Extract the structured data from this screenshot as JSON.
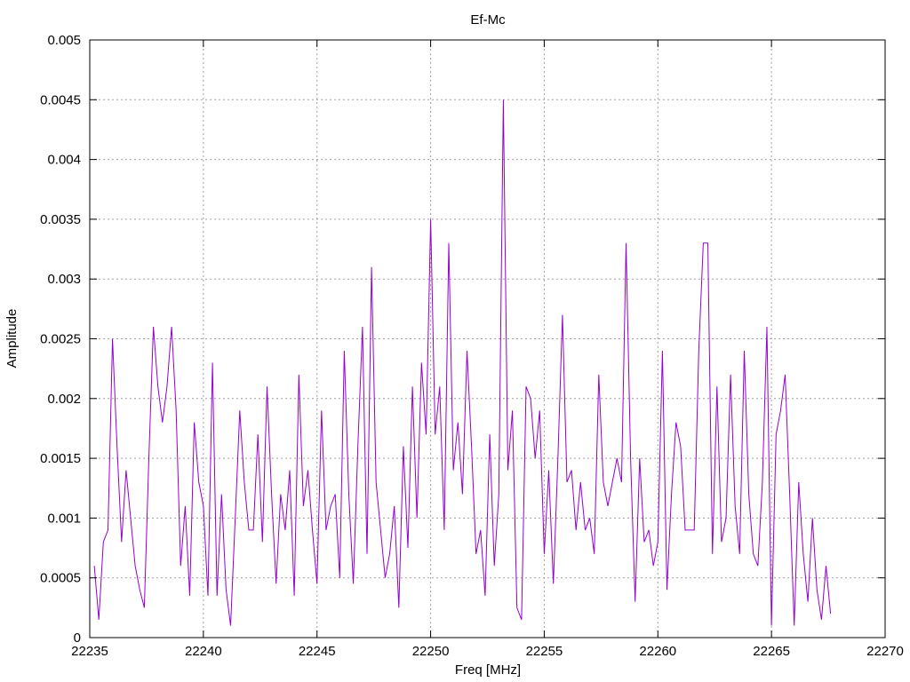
{
  "chart_data": {
    "type": "line",
    "title": "Ef-Mc",
    "xlabel": "Freq [MHz]",
    "ylabel": "Amplitude",
    "xlim": [
      22235,
      22270
    ],
    "ylim": [
      0,
      0.005
    ],
    "xticks": [
      22235,
      22240,
      22245,
      22250,
      22255,
      22260,
      22265,
      22270
    ],
    "xtick_labels": [
      "22235",
      "22240",
      "22245",
      "22250",
      "22255",
      "22260",
      "22265",
      "22270"
    ],
    "yticks": [
      0,
      0.0005,
      0.001,
      0.0015,
      0.002,
      0.0025,
      0.003,
      0.0035,
      0.004,
      0.0045,
      0.005
    ],
    "ytick_labels": [
      "0",
      "0.0005",
      "0.001",
      "0.0015",
      "0.002",
      "0.0025",
      "0.003",
      "0.0035",
      "0.004",
      "0.0045",
      "0.005"
    ],
    "grid": true,
    "series": [
      {
        "color": "#9400d3",
        "x": [
          22235.2,
          22235.4,
          22235.6,
          22235.8,
          22236.0,
          22236.2,
          22236.4,
          22236.6,
          22236.8,
          22237.0,
          22237.2,
          22237.4,
          22237.6,
          22237.8,
          22238.0,
          22238.2,
          22238.4,
          22238.6,
          22238.8,
          22239.0,
          22239.2,
          22239.4,
          22239.6,
          22239.8,
          22240.0,
          22240.2,
          22240.4,
          22240.6,
          22240.8,
          22241.0,
          22241.2,
          22241.4,
          22241.6,
          22241.8,
          22242.0,
          22242.2,
          22242.4,
          22242.6,
          22242.8,
          22243.0,
          22243.2,
          22243.4,
          22243.6,
          22243.8,
          22244.0,
          22244.2,
          22244.4,
          22244.6,
          22244.8,
          22245.0,
          22245.2,
          22245.4,
          22245.6,
          22245.8,
          22246.0,
          22246.2,
          22246.4,
          22246.6,
          22246.8,
          22247.0,
          22247.2,
          22247.4,
          22247.6,
          22247.8,
          22248.0,
          22248.2,
          22248.4,
          22248.6,
          22248.8,
          22249.0,
          22249.2,
          22249.4,
          22249.6,
          22249.8,
          22250.0,
          22250.2,
          22250.4,
          22250.6,
          22250.8,
          22251.0,
          22251.2,
          22251.4,
          22251.6,
          22251.8,
          22252.0,
          22252.2,
          22252.4,
          22252.6,
          22252.8,
          22253.0,
          22253.2,
          22253.4,
          22253.6,
          22253.8,
          22254.0,
          22254.2,
          22254.4,
          22254.6,
          22254.8,
          22255.0,
          22255.2,
          22255.4,
          22255.6,
          22255.8,
          22256.0,
          22256.2,
          22256.4,
          22256.6,
          22256.8,
          22257.0,
          22257.2,
          22257.4,
          22257.6,
          22257.8,
          22258.0,
          22258.2,
          22258.4,
          22258.6,
          22258.8,
          22259.0,
          22259.2,
          22259.4,
          22259.6,
          22259.8,
          22260.0,
          22260.2,
          22260.4,
          22260.6,
          22260.8,
          22261.0,
          22261.2,
          22261.4,
          22261.6,
          22261.8,
          22262.0,
          22262.2,
          22262.4,
          22262.6,
          22262.8,
          22263.0,
          22263.2,
          22263.4,
          22263.6,
          22263.8,
          22264.0,
          22264.2,
          22264.4,
          22264.6,
          22264.8,
          22265.0,
          22265.2,
          22265.4,
          22265.6,
          22265.8,
          22266.0,
          22266.2,
          22266.4,
          22266.6,
          22266.8,
          22267.0,
          22267.2,
          22267.4,
          22267.6
        ],
        "y": [
          0.0006,
          0.00015,
          0.0008,
          0.0009,
          0.0025,
          0.0016,
          0.0008,
          0.0014,
          0.001,
          0.0006,
          0.0004,
          0.00025,
          0.0015,
          0.0026,
          0.0021,
          0.0018,
          0.0021,
          0.0026,
          0.0019,
          0.0006,
          0.0011,
          0.00035,
          0.0018,
          0.0013,
          0.0011,
          0.00035,
          0.0023,
          0.00035,
          0.0012,
          0.0004,
          0.0001,
          0.001,
          0.0019,
          0.0013,
          0.0009,
          0.0009,
          0.0017,
          0.0008,
          0.0021,
          0.0012,
          0.00045,
          0.0012,
          0.0009,
          0.0014,
          0.00035,
          0.0022,
          0.0011,
          0.0014,
          0.0009,
          0.00045,
          0.0019,
          0.0009,
          0.0011,
          0.0012,
          0.0005,
          0.0024,
          0.0012,
          0.00045,
          0.0016,
          0.0026,
          0.0007,
          0.0031,
          0.0013,
          0.0009,
          0.0005,
          0.0007,
          0.0011,
          0.00025,
          0.0016,
          0.00075,
          0.0021,
          0.001,
          0.0023,
          0.0017,
          0.0035,
          0.0017,
          0.0021,
          0.0009,
          0.0033,
          0.0014,
          0.0018,
          0.0012,
          0.0024,
          0.0016,
          0.0007,
          0.0009,
          0.00035,
          0.0017,
          0.0006,
          0.0012,
          0.0045,
          0.0014,
          0.0019,
          0.00025,
          0.00015,
          0.0021,
          0.002,
          0.0015,
          0.0019,
          0.0007,
          0.0014,
          0.00045,
          0.0015,
          0.0027,
          0.0013,
          0.0014,
          0.0009,
          0.0013,
          0.0009,
          0.001,
          0.0007,
          0.0022,
          0.0013,
          0.0011,
          0.0013,
          0.0015,
          0.0013,
          0.0033,
          0.0015,
          0.0003,
          0.0015,
          0.0008,
          0.0009,
          0.0006,
          0.0008,
          0.0024,
          0.0004,
          0.0012,
          0.0018,
          0.0016,
          0.0009,
          0.0009,
          0.0009,
          0.0024,
          0.0033,
          0.0033,
          0.0007,
          0.0021,
          0.0008,
          0.001,
          0.0022,
          0.0011,
          0.0007,
          0.0024,
          0.0012,
          0.0007,
          0.0006,
          0.0013,
          0.0026,
          0.0001,
          0.0017,
          0.0019,
          0.0022,
          0.0012,
          0.0001,
          0.0013,
          0.0007,
          0.0003,
          0.001,
          0.0004,
          0.00015,
          0.0006,
          0.0002
        ]
      }
    ]
  }
}
